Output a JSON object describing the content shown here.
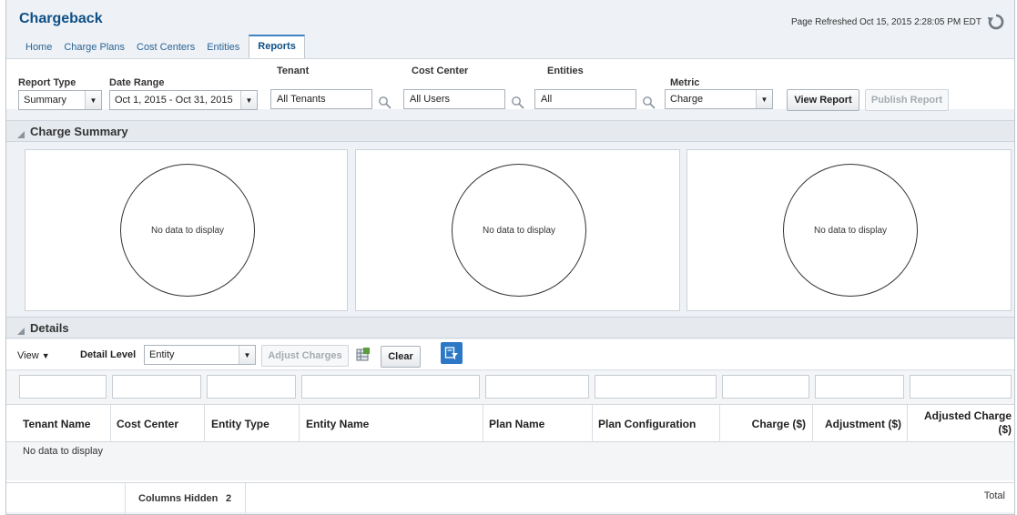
{
  "app": {
    "title": "Chargeback",
    "refreshed": "Page Refreshed Oct 15, 2015 2:28:05 PM EDT"
  },
  "tabs": [
    {
      "label": "Home",
      "active": false
    },
    {
      "label": "Charge Plans",
      "active": false
    },
    {
      "label": "Cost Centers",
      "active": false
    },
    {
      "label": "Entities",
      "active": false
    },
    {
      "label": "Reports",
      "active": true
    }
  ],
  "filters": {
    "report_type": {
      "label": "Report Type",
      "value": "Summary"
    },
    "date_range": {
      "label": "Date Range",
      "value": "Oct 1, 2015 - Oct 31, 2015"
    },
    "tenant": {
      "label": "Tenant",
      "value": "All Tenants"
    },
    "cost_center": {
      "label": "Cost Center",
      "value": "All Users"
    },
    "entities": {
      "label": "Entities",
      "value": "All"
    },
    "metric": {
      "label": "Metric",
      "value": "Charge"
    },
    "view_report": "View Report",
    "publish_report": "Publish Report"
  },
  "summary": {
    "title": "Charge Summary",
    "charts": [
      {
        "message": "No data to display"
      },
      {
        "message": "No data to display"
      },
      {
        "message": "No data to display"
      }
    ]
  },
  "details": {
    "title": "Details",
    "view_menu": "View",
    "detail_level_label": "Detail Level",
    "detail_level_value": "Entity",
    "adjust_charges": "Adjust Charges",
    "clear": "Clear",
    "columns": [
      "Tenant Name",
      "Cost Center",
      "Entity Type",
      "Entity Name",
      "Plan Name",
      "Plan Configuration",
      "Charge ($)",
      "Adjustment ($)",
      "Adjusted Charge ($)"
    ],
    "no_data": "No data to display",
    "columns_hidden_label": "Columns Hidden",
    "columns_hidden_count": "2",
    "total_label": "Total"
  },
  "colors": {
    "brand": "#0e4f86",
    "tab_accent": "#3c84c4",
    "filter_button": "#2c78c6"
  }
}
